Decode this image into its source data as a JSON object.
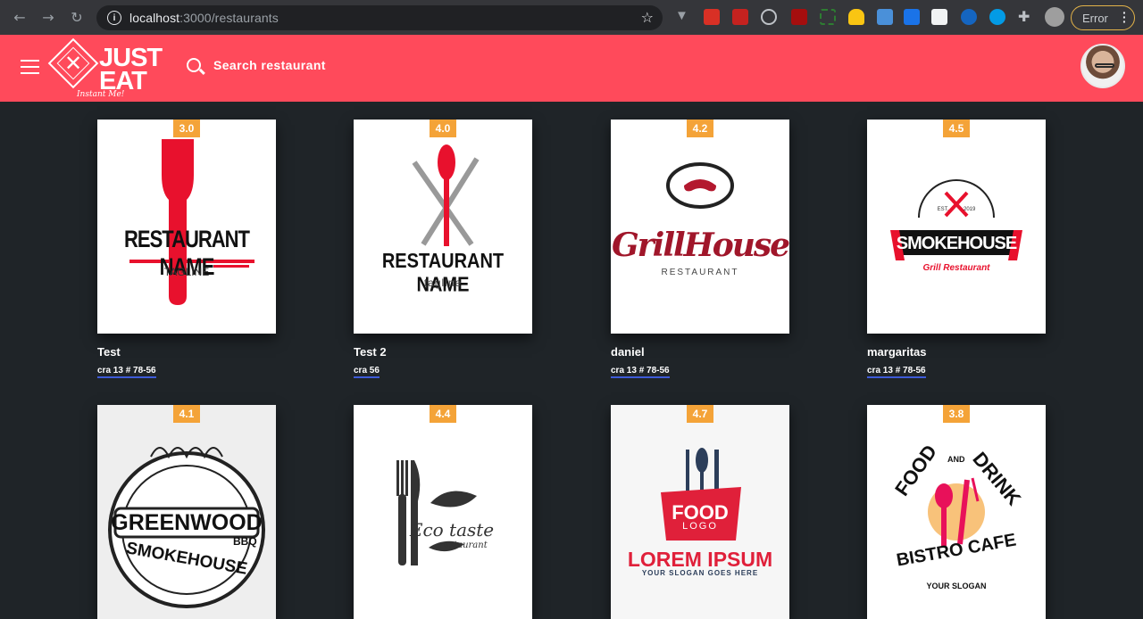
{
  "browser": {
    "url_host": "localhost",
    "url_path": ":3000/restaurants",
    "profile_button": "Error"
  },
  "header": {
    "brand_line1": "JUST",
    "brand_line2": "EAT",
    "brand_tagline": "Instant Me!",
    "search_label": "Search restaurant"
  },
  "restaurants": [
    {
      "name": "Test",
      "address": "cra 13 # 78-56",
      "rating": "3.0",
      "logo": {
        "title": "RESTAURANT NAME",
        "sub": "TAGLINE"
      }
    },
    {
      "name": "Test 2",
      "address": "cra 56",
      "rating": "4.0",
      "logo": {
        "title": "RESTAURANT NAME",
        "sub": "tagline"
      }
    },
    {
      "name": "daniel",
      "address": "cra 13 # 78-56",
      "rating": "4.2",
      "logo": {
        "title": "GrillHouse",
        "sub": "RESTAURANT"
      }
    },
    {
      "name": "margaritas",
      "address": "cra 13 # 78-56",
      "rating": "4.5",
      "logo": {
        "title": "SMOKEHOUSE",
        "sub": "Grill Restaurant",
        "est": "EST.",
        "year": "2019"
      }
    },
    {
      "name": "",
      "address": "",
      "rating": "4.1",
      "logo": {
        "title": "GREENWOOD",
        "sub": "SMOKEHOUSE",
        "extra": "BBQ"
      }
    },
    {
      "name": "",
      "address": "",
      "rating": "4.4",
      "logo": {
        "title": "Eco taste",
        "sub": "restaurant"
      }
    },
    {
      "name": "",
      "address": "",
      "rating": "4.7",
      "logo": {
        "title": "FOOD",
        "sub": "LOGO",
        "extra": "LOREM IPSUM",
        "slogan": "YOUR SLOGAN GOES HERE"
      }
    },
    {
      "name": "",
      "address": "",
      "rating": "3.8",
      "logo": {
        "title": "FOOD",
        "and": "AND",
        "title2": "DRINK",
        "sub": "BISTRO CAFE",
        "slogan": "YOUR SLOGAN"
      }
    }
  ],
  "colors": {
    "accent": "#ff4a5b",
    "rating": "#f4a338",
    "background": "#1f2428"
  }
}
